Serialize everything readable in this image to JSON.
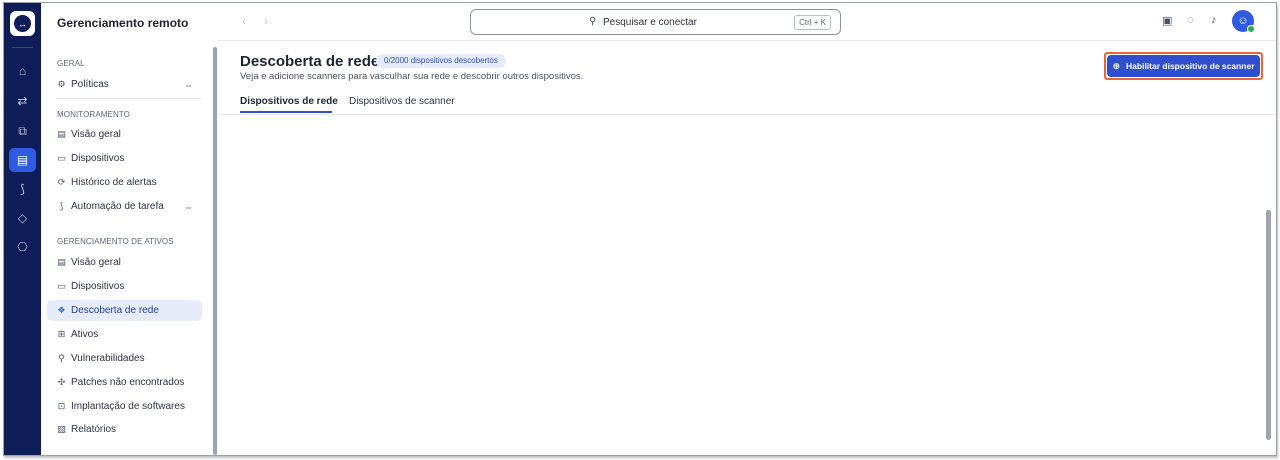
{
  "app": {
    "title": "Gerenciamento remoto"
  },
  "rail": {
    "logo_icon": "teamviewer-logo-icon",
    "items": [
      {
        "icon": "home-icon",
        "glyph": "⌂"
      },
      {
        "icon": "transfer-icon",
        "glyph": "⇄"
      },
      {
        "icon": "devices-icon",
        "glyph": "⧉"
      },
      {
        "icon": "remote-management-icon",
        "glyph": "▤"
      },
      {
        "icon": "flow-icon",
        "glyph": "⟆"
      },
      {
        "icon": "tag-icon",
        "glyph": "◇"
      },
      {
        "icon": "shield-settings-icon",
        "glyph": "⎔"
      }
    ],
    "active_index": 3
  },
  "sidebar": {
    "sections": [
      {
        "label": "GERAL"
      },
      {
        "label": "MONITORAMENTO"
      },
      {
        "label": "GERENCIAMENTO DE ATIVOS"
      }
    ],
    "items": [
      {
        "label": "Políticas",
        "icon": "gear-icon",
        "glyph": "⚙",
        "external": true
      },
      {
        "label": "Visão geral",
        "icon": "dashboard-icon",
        "glyph": "▤"
      },
      {
        "label": "Dispositivos",
        "icon": "monitor-icon",
        "glyph": "▭"
      },
      {
        "label": "Histórico de alertas",
        "icon": "alert-history-icon",
        "glyph": "⟳"
      },
      {
        "label": "Automação de tarefa",
        "icon": "automation-icon",
        "glyph": "⟆",
        "external": true
      },
      {
        "label": "Visão geral",
        "icon": "dashboard-icon",
        "glyph": "▤"
      },
      {
        "label": "Dispositivos",
        "icon": "monitor-icon",
        "glyph": "▭"
      },
      {
        "label": "Descoberta de rede",
        "icon": "network-discovery-icon",
        "glyph": "❖",
        "active": true
      },
      {
        "label": "Ativos",
        "icon": "assets-icon",
        "glyph": "⊞"
      },
      {
        "label": "Vulnerabilidades",
        "icon": "vulnerability-icon",
        "glyph": "⚲"
      },
      {
        "label": "Patches não encontrados",
        "icon": "patch-icon",
        "glyph": "✣"
      },
      {
        "label": "Implantação de softwares",
        "icon": "software-deploy-icon",
        "glyph": "⊡"
      },
      {
        "label": "Relatórios",
        "icon": "report-icon",
        "glyph": "▧"
      }
    ],
    "external_glyph": "⇔"
  },
  "topbar": {
    "back_glyph": "‹",
    "forward_glyph": "›",
    "search": {
      "placeholder": "Pesquisar e conectar",
      "shortcut": "Ctrl + K",
      "icon": "search-icon"
    },
    "icons": [
      "device-list-icon",
      "chat-icon",
      "bell-icon"
    ],
    "avatar_icon": "user-avatar-icon",
    "status_color": "#2fa84f"
  },
  "main": {
    "title": "Descoberta de rede",
    "badge": "0/2000 dispositivos descobertos",
    "subtitle": "Veja e adicione scanners para vasculhar sua rede e descobrir outros dispositivos.",
    "cta": {
      "label": "Habilitar dispositivo de scanner",
      "icon": "plus-circle-icon",
      "glyph": "⊕"
    },
    "tabs": [
      {
        "label": "Dispositivos de rede",
        "active": true
      },
      {
        "label": "Dispositivos de scanner",
        "active": false
      }
    ]
  },
  "colors": {
    "rail": "#0e1d57",
    "accent": "#2f4fcf",
    "highlight_outline": "#e8663a",
    "active_item_bg": "#e7ecfb"
  }
}
